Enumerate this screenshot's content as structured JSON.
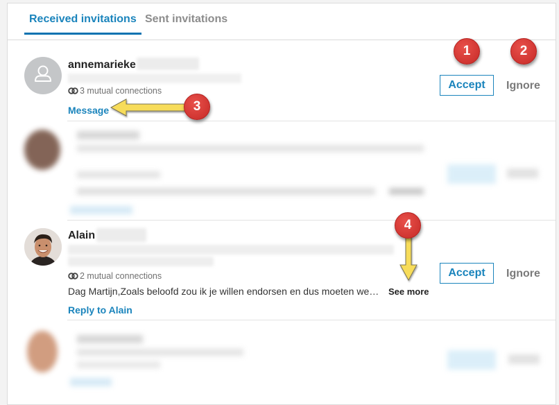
{
  "tabs": [
    {
      "label": "Received invitations",
      "active": true
    },
    {
      "label": "Sent invitations",
      "active": false
    }
  ],
  "invitations": [
    {
      "name": "annemarieke",
      "name_redacted": true,
      "headline_redacted": true,
      "mutual_connections": "3 mutual connections",
      "action_link": "Message",
      "accept_label": "Accept",
      "ignore_label": "Ignore",
      "avatar": "placeholder-person-icon"
    },
    {
      "blurred": true,
      "accept_label": "Accept",
      "ignore_label": "Ignore"
    },
    {
      "name": "Alain",
      "name_redacted": true,
      "headline_redacted": true,
      "mutual_connections": "2 mutual connections",
      "message": "Dag Martijn,Zoals beloofd zou ik je willen endorsen en dus moeten we…",
      "see_more": "See more",
      "action_link": "Reply to Alain",
      "accept_label": "Accept",
      "ignore_label": "Ignore",
      "avatar": "profile-photo"
    },
    {
      "blurred": true,
      "accept_label": "Accept",
      "ignore_label": "Ignore"
    }
  ],
  "annotations": [
    {
      "number": "1",
      "target": "Accept"
    },
    {
      "number": "2",
      "target": "Ignore"
    },
    {
      "number": "3",
      "target": "Message"
    },
    {
      "number": "4",
      "target": "See more"
    }
  ],
  "colors": {
    "accent": "#1a84bc",
    "tab_underline": "#0a73b1",
    "badge_red": "#d93a36",
    "arrow_yellow": "#f7dc5a"
  }
}
